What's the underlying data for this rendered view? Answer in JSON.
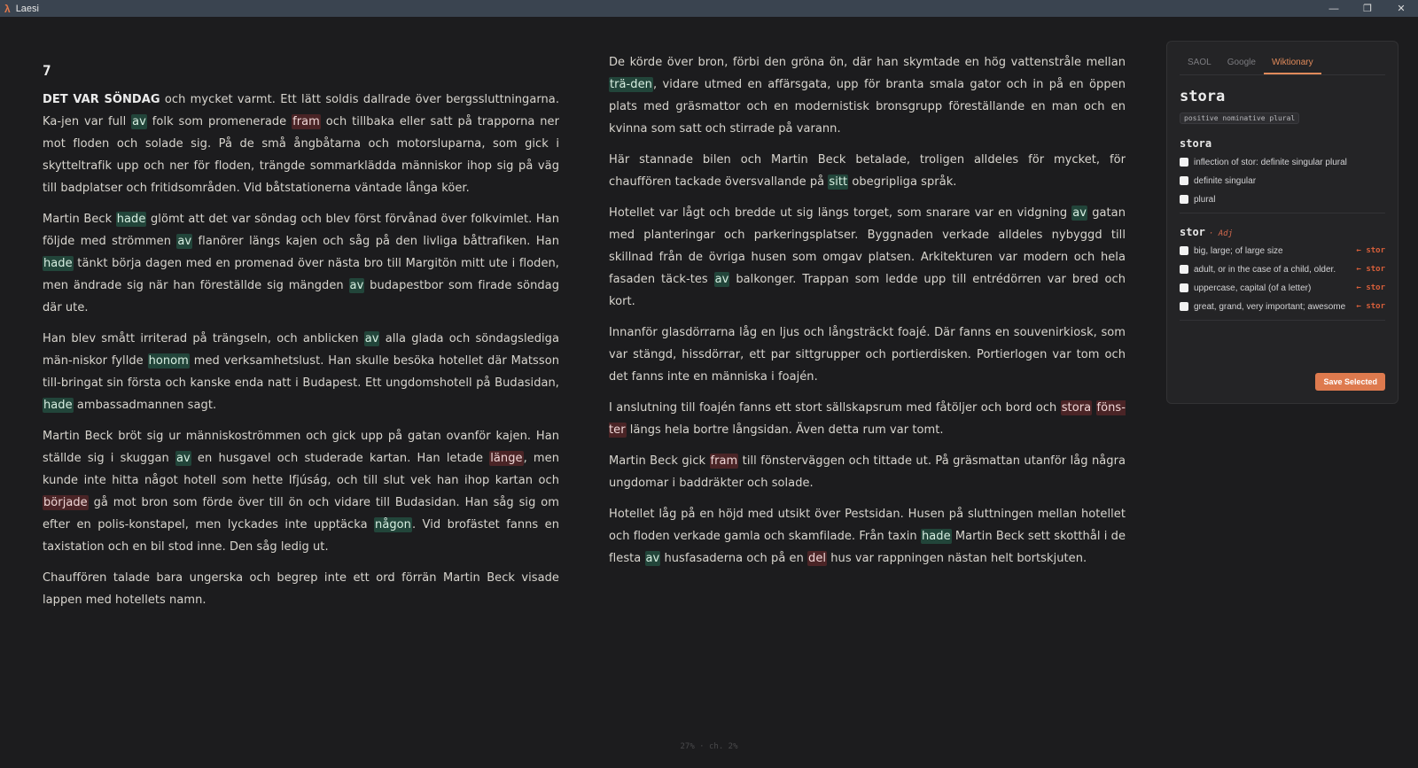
{
  "app": {
    "title": "Laesi",
    "logo_glyph": "λ"
  },
  "window_controls": {
    "minimize": "—",
    "restore": "❐",
    "close": "✕"
  },
  "chapter": {
    "number": "7"
  },
  "left_column": [
    [
      {
        "t": "DET VAR SÖNDAG",
        "s": "b"
      },
      {
        "t": " och mycket varmt. Ett lätt soldis dallrade över bergssluttningarna. Ka-jen var full "
      },
      {
        "t": "av",
        "s": "g"
      },
      {
        "t": " folk som promenerade "
      },
      {
        "t": "fram",
        "s": "r"
      },
      {
        "t": " och tillbaka eller satt på trapporna ner mot floden och solade sig. På de små ångbåtarna och motorsluparna, som gick i skytteltrafik upp och ner för floden, trängde sommarklädda människor ihop sig på väg till badplatser och fritidsområden. Vid båtstationerna väntade långa köer."
      }
    ],
    [
      {
        "t": "Martin Beck "
      },
      {
        "t": "hade",
        "s": "g"
      },
      {
        "t": " glömt att det var söndag och blev först förvånad över folkvimlet. Han följde med strömmen "
      },
      {
        "t": "av",
        "s": "g"
      },
      {
        "t": " flanörer längs kajen och såg på den livliga båttrafiken. Han "
      },
      {
        "t": "hade",
        "s": "g"
      },
      {
        "t": " tänkt börja dagen med en promenad över nästa bro till Margitön mitt ute i floden, men ändrade sig när han föreställde sig mängden "
      },
      {
        "t": "av",
        "s": "g"
      },
      {
        "t": " budapestbor som firade söndag där ute."
      }
    ],
    [
      {
        "t": "Han blev smått irriterad på trängseln, och anblicken "
      },
      {
        "t": "av",
        "s": "g"
      },
      {
        "t": " alla glada och söndagslediga män-niskor fyllde "
      },
      {
        "t": "honom",
        "s": "g"
      },
      {
        "t": " med verksamhetslust. Han skulle besöka hotellet där Matsson till-bringat sin första och kanske enda natt i Budapest. Ett ungdomshotell på Budasidan, "
      },
      {
        "t": "hade",
        "s": "g"
      },
      {
        "t": " ambassadmannen sagt."
      }
    ],
    [
      {
        "t": "Martin Beck bröt sig ur människoströmmen och gick upp på gatan ovanför kajen. Han ställde sig i skuggan "
      },
      {
        "t": "av",
        "s": "g"
      },
      {
        "t": " en husgavel och studerade kartan. Han letade "
      },
      {
        "t": "länge",
        "s": "r"
      },
      {
        "t": ", men kunde inte hitta något hotell som hette Ifjúság, och till slut vek han ihop kartan och "
      },
      {
        "t": "började",
        "s": "r"
      },
      {
        "t": " gå mot bron som förde över till ön och vidare till Budasidan. Han såg sig om efter en polis-konstapel, men lyckades inte upptäcka "
      },
      {
        "t": "någon",
        "s": "g"
      },
      {
        "t": ". Vid brofästet fanns en taxistation och en bil stod inne. Den såg ledig ut."
      }
    ],
    [
      {
        "t": "Chauffören talade bara ungerska och begrep inte ett ord förrän Martin Beck visade lappen med hotellets namn."
      }
    ]
  ],
  "right_column": [
    [
      {
        "t": "De körde över bron, förbi den gröna ön, där han skymtade en hög vattenstråle mellan "
      },
      {
        "t": "trä-den",
        "s": "g"
      },
      {
        "t": ", vidare utmed en affärsgata, upp för branta smala gator och in på en öppen plats med gräsmattor och en modernistisk bronsgrupp föreställande en man och en kvinna som satt och stirrade på varann."
      }
    ],
    [
      {
        "t": "Här stannade bilen och Martin Beck betalade, troligen alldeles för mycket, för chauffören tackade översvallande på "
      },
      {
        "t": "sitt",
        "s": "g"
      },
      {
        "t": " obegripliga språk."
      }
    ],
    [
      {
        "t": "Hotellet var lågt och bredde ut sig längs torget, som snarare var en vidgning "
      },
      {
        "t": "av",
        "s": "g"
      },
      {
        "t": " gatan med planteringar och parkeringsplatser. Byggnaden verkade alldeles nybyggd till skillnad från de övriga husen som omgav platsen. Arkitekturen var modern och hela fasaden täck-tes "
      },
      {
        "t": "av",
        "s": "g"
      },
      {
        "t": " balkonger. Trappan som ledde upp till entrédörren var bred och kort."
      }
    ],
    [
      {
        "t": "Innanför glasdörrarna låg en ljus och långsträckt foajé. Där fanns en souvenirkiosk, som var stängd, hissdörrar, ett par sittgrupper och portierdisken. Portierlogen var tom och det fanns inte en människa i foajén."
      }
    ],
    [
      {
        "t": "I anslutning till foajén fanns ett stort sällskapsrum med fåtöljer och bord och "
      },
      {
        "t": "stora",
        "s": "r"
      },
      {
        "t": " "
      },
      {
        "t": "föns-ter",
        "s": "r"
      },
      {
        "t": " längs hela bortre långsidan. Även detta rum var tomt."
      }
    ],
    [
      {
        "t": "Martin Beck gick "
      },
      {
        "t": "fram",
        "s": "r"
      },
      {
        "t": " till fönsterväggen och tittade ut. På gräsmattan utanför låg några ungdomar i baddräkter och solade."
      }
    ],
    [
      {
        "t": "Hotellet låg på en höjd med utsikt över Pestsidan. Husen på sluttningen mellan hotellet och floden verkade gamla och skamfilade. Från taxin "
      },
      {
        "t": "hade",
        "s": "g"
      },
      {
        "t": " Martin Beck sett skotthål i de flesta "
      },
      {
        "t": "av",
        "s": "g"
      },
      {
        "t": " husfasaderna och på en "
      },
      {
        "t": "del",
        "s": "r"
      },
      {
        "t": " hus var rappningen nästan helt bortskjuten."
      }
    ]
  ],
  "status": {
    "text": "27% · ch. 2%"
  },
  "dictionary": {
    "tabs": [
      {
        "label": "SAOL",
        "active": false
      },
      {
        "label": "Google",
        "active": false
      },
      {
        "label": "Wiktionary",
        "active": true
      }
    ],
    "word": "stora",
    "tag": "positive nominative plural",
    "sections": [
      {
        "heading": "stora",
        "pos": "",
        "defs": [
          {
            "text": "inflection of stor: definite singular plural",
            "link": ""
          },
          {
            "text": "definite singular",
            "link": ""
          },
          {
            "text": "plural",
            "link": ""
          }
        ]
      },
      {
        "heading": "stor",
        "pos": "· Adj",
        "defs": [
          {
            "text": "big, large; of large size",
            "link": "← stor"
          },
          {
            "text": "adult, or in the case of a child, older.",
            "link": "← stor"
          },
          {
            "text": "uppercase, capital (of a letter)",
            "link": "← stor"
          },
          {
            "text": "great, grand, very important; awesome",
            "link": "← stor"
          }
        ]
      }
    ],
    "save_label": "Save Selected"
  },
  "colors": {
    "accent": "#de7a4e",
    "known_highlight": "#22453a",
    "learning_highlight": "#4a2426",
    "background": "#1c1c1e"
  }
}
